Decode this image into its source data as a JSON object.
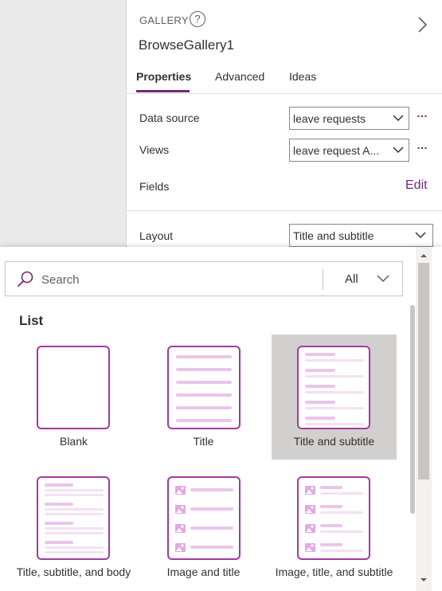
{
  "panel": {
    "type_label": "GALLERY",
    "help_glyph": "?",
    "control_name": "BrowseGallery1",
    "tabs": [
      {
        "label": "Properties",
        "active": true
      },
      {
        "label": "Advanced",
        "active": false
      },
      {
        "label": "Ideas",
        "active": false
      }
    ],
    "data_source": {
      "label": "Data source",
      "value": "leave requests"
    },
    "views": {
      "label": "Views",
      "value": "leave request A..."
    },
    "fields": {
      "label": "Fields",
      "edit_label": "Edit"
    },
    "layout": {
      "label": "Layout",
      "value": "Title and subtitle"
    },
    "ellipsis": "…"
  },
  "flyout": {
    "search_placeholder": "Search",
    "filter_value": "All",
    "section_title": "List",
    "layouts": [
      {
        "label": "Blank",
        "selected": false
      },
      {
        "label": "Title",
        "selected": false
      },
      {
        "label": "Title and subtitle",
        "selected": true
      },
      {
        "label": "Title, subtitle, and body",
        "selected": false
      },
      {
        "label": "Image and title",
        "selected": false
      },
      {
        "label": "Image, title, and subtitle",
        "selected": false
      }
    ]
  },
  "colors": {
    "accent": "#742774",
    "thumb_border": "#a33aa3",
    "thumb_line": "#e9c6e9",
    "thumb_line_light": "#f3e1f3",
    "selected_bg": "#d2d0ce"
  },
  "icons": [
    "help-icon",
    "chevron-right-icon",
    "chevron-down-icon",
    "search-icon",
    "image-icon"
  ]
}
